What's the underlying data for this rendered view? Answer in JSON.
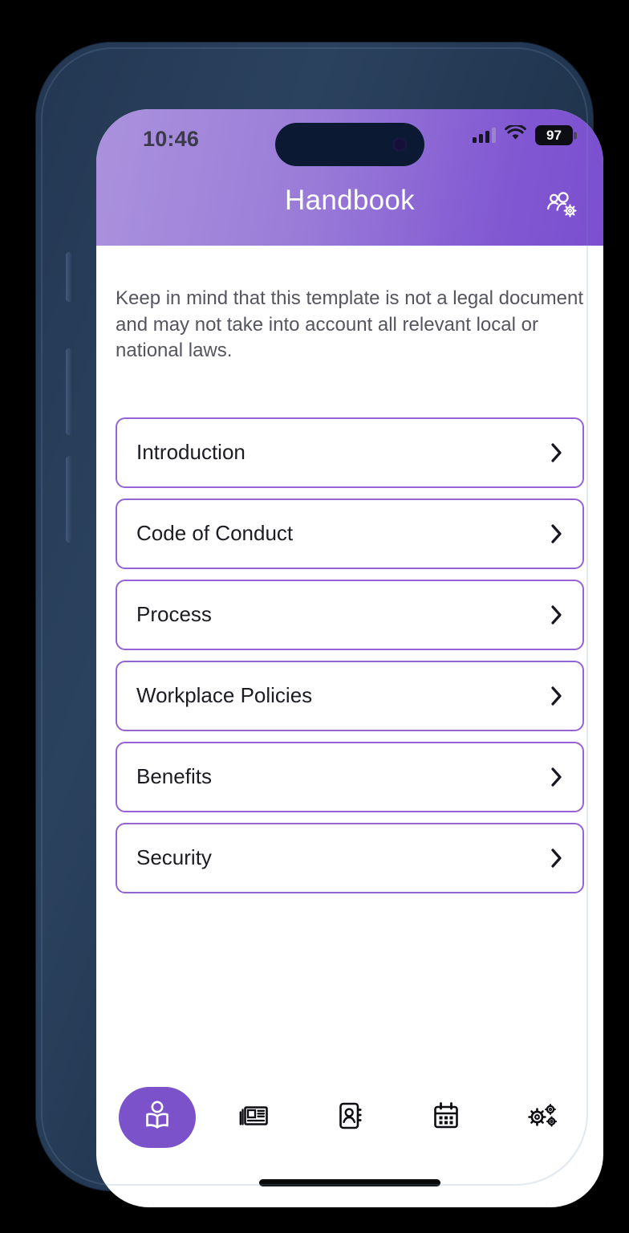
{
  "status_bar": {
    "time": "10:46",
    "battery_level": "97",
    "signal_icon": "cellular-signal-icon",
    "wifi_icon": "wifi-icon",
    "battery_icon": "battery-icon"
  },
  "header": {
    "title": "Handbook",
    "action_icon": "users-cog-icon",
    "gradient_start": "#ab92dd",
    "gradient_end": "#7b4fd0"
  },
  "main": {
    "intro_note": "Keep in mind that this template is not a legal document and may not take into account all relevant local or national laws.",
    "sections": [
      {
        "label": "Introduction",
        "chevron": "chevron-right-icon"
      },
      {
        "label": "Code of Conduct",
        "chevron": "chevron-right-icon"
      },
      {
        "label": "Process",
        "chevron": "chevron-right-icon"
      },
      {
        "label": "Workplace Policies",
        "chevron": "chevron-right-icon"
      },
      {
        "label": "Benefits",
        "chevron": "chevron-right-icon"
      },
      {
        "label": "Security",
        "chevron": "chevron-right-icon"
      }
    ],
    "card_border_color": "#9563d6"
  },
  "bottom_nav": {
    "active_background": "#7b52c9",
    "items": [
      {
        "icon": "book-reader-icon",
        "active": true
      },
      {
        "icon": "newspaper-icon",
        "active": false
      },
      {
        "icon": "address-book-icon",
        "active": false
      },
      {
        "icon": "calendar-icon",
        "active": false
      },
      {
        "icon": "cogs-icon",
        "active": false
      }
    ]
  }
}
